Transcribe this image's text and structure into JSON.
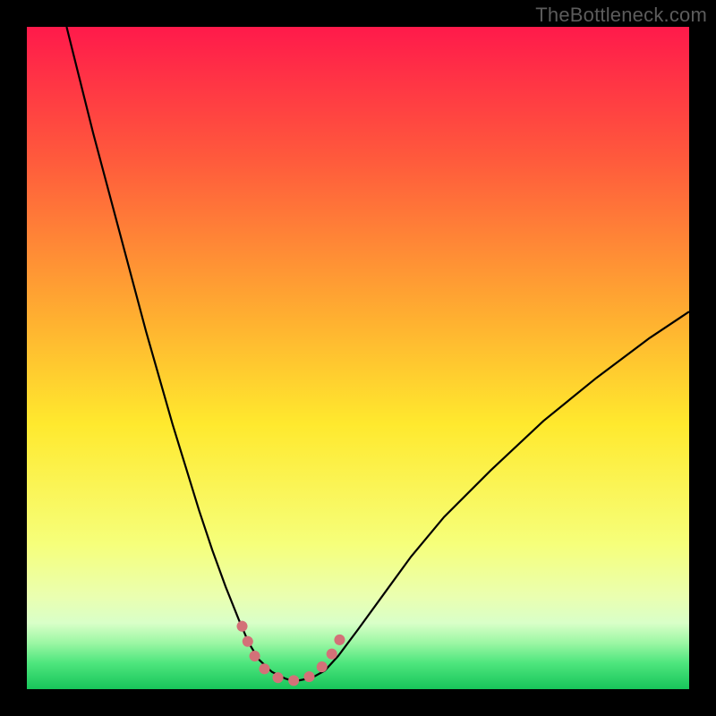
{
  "watermark": "TheBottleneck.com",
  "chart_data": {
    "type": "line",
    "title": "",
    "xlabel": "",
    "ylabel": "",
    "xlim": [
      0,
      100
    ],
    "ylim": [
      0,
      100
    ],
    "gradient_stops": [
      {
        "offset": 0,
        "color": "#ff1a4b"
      },
      {
        "offset": 20,
        "color": "#ff5a3c"
      },
      {
        "offset": 45,
        "color": "#ffb330"
      },
      {
        "offset": 60,
        "color": "#ffe92e"
      },
      {
        "offset": 78,
        "color": "#f6ff7a"
      },
      {
        "offset": 86,
        "color": "#eaffb0"
      },
      {
        "offset": 90,
        "color": "#d9ffc8"
      },
      {
        "offset": 93,
        "color": "#9cf7a4"
      },
      {
        "offset": 96,
        "color": "#4fe67e"
      },
      {
        "offset": 100,
        "color": "#17c55a"
      }
    ],
    "series": [
      {
        "name": "bottleneck-curve",
        "stroke": "#000000",
        "stroke_width": 2.2,
        "x": [
          6,
          8,
          10,
          12,
          14,
          16,
          18,
          20,
          22,
          24,
          26,
          28,
          30,
          32,
          33.5,
          35,
          37,
          39,
          40,
          41,
          43,
          45,
          47,
          50,
          54,
          58,
          63,
          70,
          78,
          86,
          94,
          100
        ],
        "y": [
          100,
          92,
          84,
          76.5,
          69,
          61.5,
          54,
          47,
          40,
          33.5,
          27,
          21,
          15.5,
          10.5,
          7,
          4.5,
          2.6,
          1.6,
          1.3,
          1.3,
          1.7,
          2.8,
          5,
          9,
          14.5,
          20,
          26,
          33,
          40.5,
          47,
          53,
          57
        ]
      },
      {
        "name": "bottom-highlight",
        "stroke": "#d37178",
        "stroke_width": 12,
        "linecap": "round",
        "dash": "0.1 18",
        "x": [
          32.5,
          33.5,
          34.5,
          35.5,
          36.5,
          37.5,
          38.5,
          39.5,
          40.5,
          41.5,
          42.5,
          43.5,
          44.5,
          45.5,
          46.5,
          47.5
        ],
        "y": [
          9.5,
          6.8,
          4.8,
          3.4,
          2.5,
          1.9,
          1.5,
          1.3,
          1.3,
          1.4,
          1.8,
          2.4,
          3.3,
          4.5,
          6.0,
          8.0
        ]
      }
    ]
  }
}
